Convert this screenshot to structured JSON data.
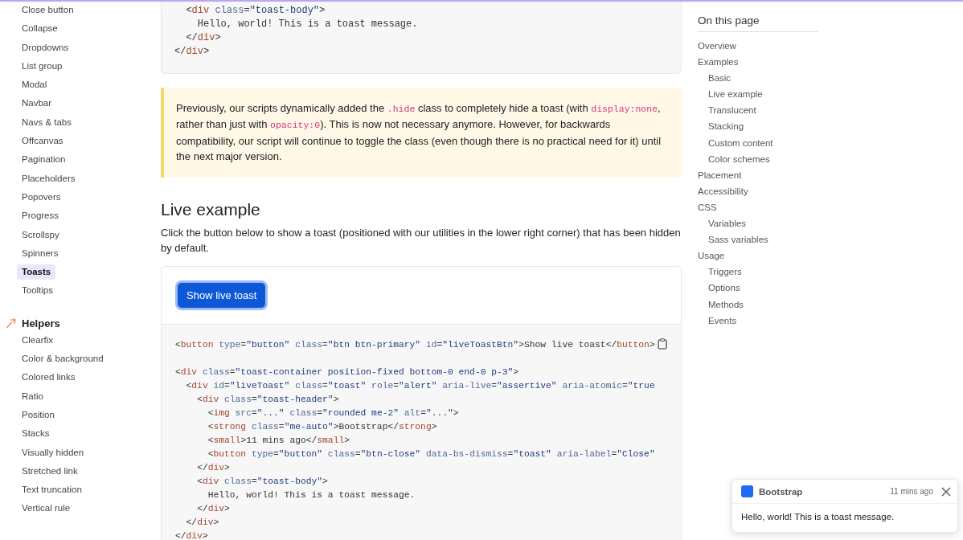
{
  "sidebar": {
    "groups": [
      {
        "items": [
          {
            "label": "Close button",
            "selected": false
          },
          {
            "label": "Collapse",
            "selected": false
          },
          {
            "label": "Dropdowns",
            "selected": false
          },
          {
            "label": "List group",
            "selected": false
          },
          {
            "label": "Modal",
            "selected": false
          },
          {
            "label": "Navbar",
            "selected": false
          },
          {
            "label": "Navs & tabs",
            "selected": false
          },
          {
            "label": "Offcanvas",
            "selected": false
          },
          {
            "label": "Pagination",
            "selected": false
          },
          {
            "label": "Placeholders",
            "selected": false
          },
          {
            "label": "Popovers",
            "selected": false
          },
          {
            "label": "Progress",
            "selected": false
          },
          {
            "label": "Scrollspy",
            "selected": false
          },
          {
            "label": "Spinners",
            "selected": false
          },
          {
            "label": "Toasts",
            "selected": true
          },
          {
            "label": "Tooltips",
            "selected": false
          }
        ]
      },
      {
        "title": "Helpers",
        "items": [
          {
            "label": "Clearfix",
            "selected": false
          },
          {
            "label": "Color & background",
            "selected": false
          },
          {
            "label": "Colored links",
            "selected": false
          },
          {
            "label": "Ratio",
            "selected": false
          },
          {
            "label": "Position",
            "selected": false
          },
          {
            "label": "Stacks",
            "selected": false
          },
          {
            "label": "Visually hidden",
            "selected": false
          },
          {
            "label": "Stretched link",
            "selected": false
          },
          {
            "label": "Text truncation",
            "selected": false
          },
          {
            "label": "Vertical rule",
            "selected": false
          }
        ]
      }
    ]
  },
  "main": {
    "code_top": [
      "  <div class=\"toast-body\">",
      "    Hello, world! This is a toast message.",
      "  </div>",
      "</div>"
    ],
    "callout": [
      {
        "kind": "text",
        "text": "Previously, our scripts dynamically added the "
      },
      {
        "kind": "code",
        "text": ".hide"
      },
      {
        "kind": "text",
        "text": " class to completely hide a toast (with "
      },
      {
        "kind": "code",
        "text": "display:none"
      },
      {
        "kind": "text",
        "text": ", rather than just with "
      },
      {
        "kind": "code",
        "text": "opacity:0"
      },
      {
        "kind": "text",
        "text": "). This is now not necessary anymore. However, for backwards compatibility, our script will continue to toggle the class (even though there is no practical need for it) until the next major version."
      }
    ],
    "heading": "Live example",
    "intro": "Click the button below to show a toast (positioned with our utilities in the lower right corner) that has been hidden by default.",
    "button": "Show live toast",
    "code": [
      [
        "<button type=\"button\" class=\"btn btn-primary\" id=\"liveToastBtn\">Show live toast</button>"
      ],
      [
        "<div class=\"toast-container position-fixed bottom-0 end-0 p-3\">",
        "  <div id=\"liveToast\" class=\"toast\" role=\"alert\" aria-live=\"assertive\" aria-atomic=\"true",
        "    <div class=\"toast-header\">",
        "      <img src=\"...\" class=\"rounded me-2\" alt=\"...\">",
        "      <strong class=\"me-auto\">Bootstrap</strong>",
        "      <small>11 mins ago</small>",
        "      <button type=\"button\" class=\"btn-close\" data-bs-dismiss=\"toast\" aria-label=\"Close\"",
        "    </div>",
        "    <div class=\"toast-body\">",
        "      Hello, world! This is a toast message.",
        "    </div>",
        "  </div>",
        "</div>"
      ]
    ]
  },
  "toc": {
    "title": "On this page",
    "items": [
      {
        "label": "Overview"
      },
      {
        "label": "Examples",
        "children": [
          {
            "label": "Basic"
          },
          {
            "label": "Live example"
          },
          {
            "label": "Translucent"
          },
          {
            "label": "Stacking"
          },
          {
            "label": "Custom content"
          },
          {
            "label": "Color schemes"
          }
        ]
      },
      {
        "label": "Placement"
      },
      {
        "label": "Accessibility"
      },
      {
        "label": "CSS",
        "children": [
          {
            "label": "Variables"
          },
          {
            "label": "Sass variables"
          }
        ]
      },
      {
        "label": "Usage",
        "children": [
          {
            "label": "Triggers"
          },
          {
            "label": "Options"
          },
          {
            "label": "Methods"
          },
          {
            "label": "Events"
          }
        ]
      }
    ]
  },
  "toast": {
    "title": "Bootstrap",
    "time": "11 mins ago",
    "body": "Hello, world! This is a toast message."
  }
}
